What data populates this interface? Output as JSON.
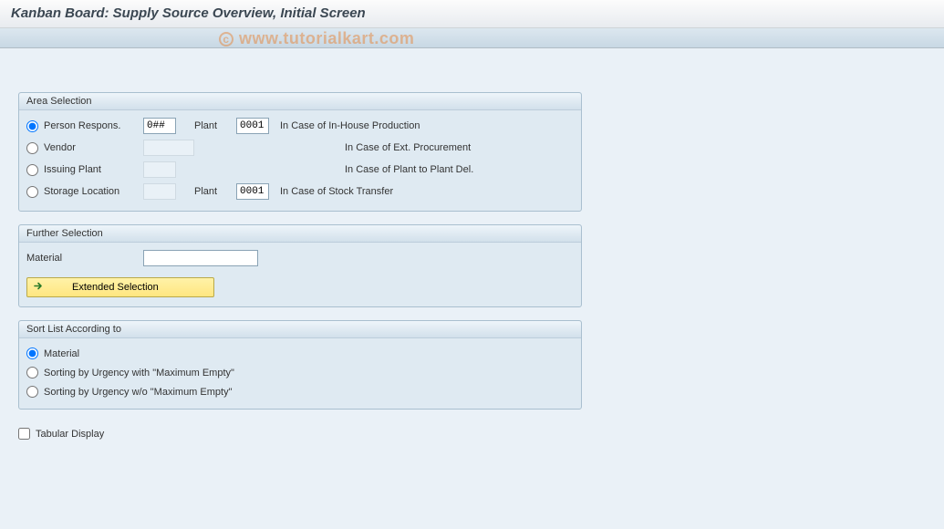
{
  "title": "Kanban Board: Supply Source Overview, Initial Screen",
  "watermark": "www.tutorialkart.com",
  "area_selection": {
    "header": "Area Selection",
    "rows": [
      {
        "label": "Person Respons.",
        "value": "0##",
        "plant_label": "Plant",
        "plant_value": "0001",
        "desc": "In Case of In-House Production",
        "selected": true
      },
      {
        "label": "Vendor",
        "value": "",
        "plant_label": "",
        "plant_value": "",
        "desc": "In Case of Ext. Procurement",
        "selected": false
      },
      {
        "label": "Issuing Plant",
        "value": "",
        "plant_label": "",
        "plant_value": "",
        "desc": "In Case of Plant to Plant Del.",
        "selected": false
      },
      {
        "label": "Storage Location",
        "value": "",
        "plant_label": "Plant",
        "plant_value": "0001",
        "desc": "In Case of Stock Transfer",
        "selected": false
      }
    ]
  },
  "further_selection": {
    "header": "Further Selection",
    "material_label": "Material",
    "material_value": "",
    "extended_btn": "Extended Selection"
  },
  "sort": {
    "header": "Sort List According to",
    "options": [
      "Material",
      "Sorting by Urgency with \"Maximum Empty\"",
      "Sorting by Urgency w/o \"Maximum Empty\""
    ],
    "selected": 0
  },
  "tabular_label": "Tabular Display",
  "tabular_checked": false
}
